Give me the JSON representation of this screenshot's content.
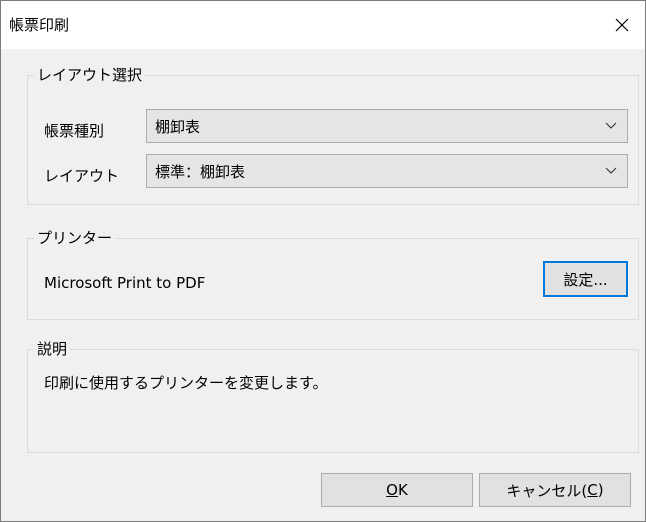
{
  "window": {
    "title": "帳票印刷",
    "close_icon": "close-icon"
  },
  "layout_group": {
    "legend": "レイアウト選択",
    "form_type_label": "帳票種別",
    "form_type_value": "棚卸表",
    "layout_label": "レイアウト",
    "layout_value": "標準：棚卸表"
  },
  "printer_group": {
    "legend": "プリンター",
    "printer_name": "Microsoft Print to PDF",
    "settings_button": "設定..."
  },
  "description_group": {
    "legend": "説明",
    "text": "印刷に使用するプリンターを変更します。"
  },
  "buttons": {
    "ok_mnemonic": "O",
    "ok_rest": "K",
    "cancel_prefix": "キャンセル(",
    "cancel_mnemonic": "C",
    "cancel_suffix": ")"
  },
  "colors": {
    "window_bg": "#f0f0f0",
    "titlebar_bg": "#ffffff",
    "focus_border": "#0078d7"
  }
}
